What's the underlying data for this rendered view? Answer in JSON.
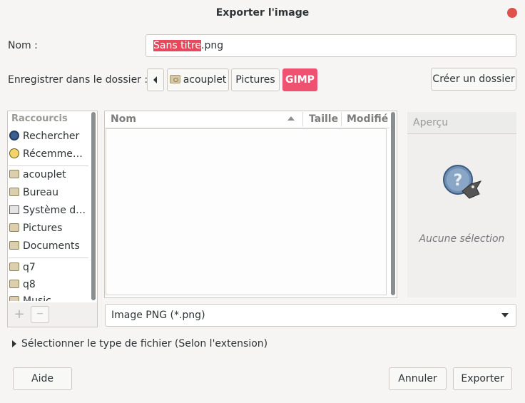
{
  "dialog": {
    "title": "Exporter l'image"
  },
  "name_row": {
    "label": "Nom :",
    "selected_part": "Sans titre",
    "extension_part": ".png"
  },
  "folder_row": {
    "label": "Enregistrer dans le dossier :",
    "crumbs": [
      "acouplet",
      "Pictures",
      "GIMP"
    ],
    "create_folder_label": "Créer un dossier"
  },
  "sidebar": {
    "header": "Raccourcis",
    "items": [
      "Rechercher",
      "Récemme…",
      "acouplet",
      "Bureau",
      "Système d…",
      "Pictures",
      "Documents",
      "q7",
      "q8",
      "Music"
    ],
    "add_label": "+",
    "remove_label": "—"
  },
  "file_list": {
    "columns": [
      "Nom",
      "Taille",
      "Modifié"
    ]
  },
  "preview": {
    "header": "Aperçu",
    "empty_text": "Aucune sélection"
  },
  "filter": {
    "selected": "Image PNG (*.png)"
  },
  "filetype_expander": {
    "label": "Sélectionner le type de fichier (Selon l'extension)"
  },
  "buttons": {
    "help": "Aide",
    "cancel": "Annuler",
    "export": "Exporter"
  },
  "colors": {
    "accent": "#ee5270",
    "close": "#e0504c"
  }
}
